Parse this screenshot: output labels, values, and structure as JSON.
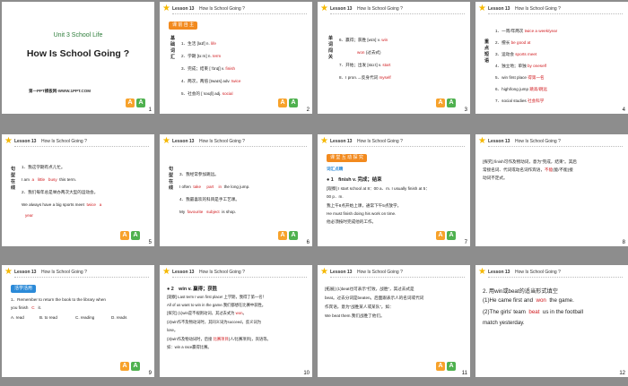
{
  "hdr": {
    "lesson": "Lesson 13",
    "title": "How Is School Going ?"
  },
  "s1": {
    "unit": "Unit 3 School Life",
    "title": "How Is School Going ?",
    "footer": "第一PPT模板网-WWW.1PPT.COM",
    "num": "1"
  },
  "s2": {
    "tag": "课 前 自 主",
    "side": "基础词汇",
    "num": "2",
    "rows": [
      {
        "lead": "1．生活 [laɪf] n.",
        "ans": "life"
      },
      {
        "lead": "2．学期 [tɜːm] n.",
        "ans": "term"
      },
      {
        "lead": "3．完成；结束 [ˈfɪnɪʃ] v.",
        "ans": "finish"
      },
      {
        "lead": "4．两次，两倍 [twaɪs] adv.",
        "ans": "twice"
      },
      {
        "lead": "5．社会的 [ˈsəʊʃl] adj.",
        "ans": "social"
      }
    ]
  },
  "s3": {
    "side": "单词闯关",
    "num": "3",
    "rows": [
      {
        "lead": "6．赢得；获胜 [wɪn] v.",
        "ans": "win"
      },
      {
        "lead": "",
        "ans": "won",
        "tail": "(过去式)"
      },
      {
        "lead": "7．开始；出发 [stɑːt] v.",
        "ans": "start"
      },
      {
        "lead": "8．I pron.→反身代词",
        "ans": "myself"
      }
    ]
  },
  "s4": {
    "side": "重点短语",
    "num": "4",
    "rows": [
      {
        "lead": "1．一周/年两次",
        "ans": "twice a week/year"
      },
      {
        "lead": "2．擅长",
        "ans": "be good at"
      },
      {
        "lead": "3．运动会",
        "ans": "sports meet"
      },
      {
        "lead": "4．独立地；单独",
        "ans": "by oneself"
      },
      {
        "lead": "5．win first place",
        "ans": "得第一名"
      },
      {
        "lead": "6．high/long jump",
        "ans": "跳高/跳远"
      },
      {
        "lead": "7．social studies",
        "ans": "社会科学"
      }
    ]
  },
  "s5": {
    "side": "句型在线",
    "num": "5",
    "l1": "1．我这学期有点儿忙。",
    "l2a": "I am",
    "a1": "a",
    "a2": "little",
    "a3": "busy",
    "l2b": "this term.",
    "l3": "2．我们每年总是举办两次大型的运动会。",
    "l4a": "We always have a big sports meet",
    "a4": "twice",
    "a5": "a",
    "a6": "year"
  },
  "s6": {
    "side": "句型在线",
    "num": "6",
    "l1": "3．我经常参加跳远。",
    "l2a": "I often",
    "a1": "take",
    "a2": "part",
    "a3": "in",
    "l2b": "the long jump.",
    "l3": "4．我最喜欢的科目是手工艺课。",
    "l4a": "My",
    "a4": "favourite",
    "a5": "subject",
    "l4b": "is shop."
  },
  "s7": {
    "tag": "课 堂 互 动 探 究",
    "sub": "词汇点睛",
    "num": "7",
    "head": "● 1　finish v. 完成；结束",
    "l1": "[观察] I start school at 8：00 a．m. I usually finish at 5：",
    "l2": "00 p．m.",
    "l3": "我上午8点开始上课，通常下午5点放学。",
    "l4": "He must finish doing his work on time.",
    "l5": "他必须按时完成他的工作。"
  },
  "s8": {
    "num": "8",
    "l1": "[探究] finish可作及物动词，意为“完成，结束”。其后",
    "l2": "常接名词、代词或动名词作宾语，",
    "ans": "不能",
    "l2b": "(能/不能)接",
    "l3": "动词不定式。"
  },
  "s9": {
    "tag": "活学活用",
    "num": "9",
    "l1": "1．Remember to return the book to the library when",
    "l2a": "you finish",
    "ans": "C",
    "l2b": "it.",
    "opts": [
      "A. read",
      "B. to read",
      "C. reading",
      "D. reads"
    ]
  },
  "s10": {
    "num": "10",
    "head": "● 2　win v. 赢得；获胜",
    "l1": "[观察] Last term I won first place! 上学期，我得了第一名！",
    "l2": "All of us want to win in the game.我们都想在比赛中获胜。",
    "l3": "[探究] (1)win是不规则动词，其过去式为",
    "ans1": "won",
    "l3b": "。",
    "l4": "(2)win作不及物动词时，其同义词为succeed，反义词为",
    "l5": "lose。",
    "l6": "(3)win作及物动词时，后接",
    "ans2": "比赛项目",
    "l6b": "(人/比赛项目)，宾语等。",
    "l7": "如：win a race赢得比赛。"
  },
  "s11": {
    "num": "11",
    "l1": "[拓展] (1)beat也可表示“打败，战胜”，其过去式是",
    "l2": "beat。过去分词是beaten。后面跟表示人的名词或代词",
    "l3": "作宾语，意为“战胜某人或某队”。如：",
    "l4": "We beat them.我们战胜了他们。"
  },
  "s12": {
    "num": "12",
    "l1": "2. 用win或beat的适当形式填空",
    "l2a": "(1)He came first and",
    "ans1": "won",
    "l2b": "the game.",
    "l3a": "(2)The girls' team",
    "ans2": "beat",
    "l3b": "us in the football",
    "l4": "match yesterday."
  }
}
